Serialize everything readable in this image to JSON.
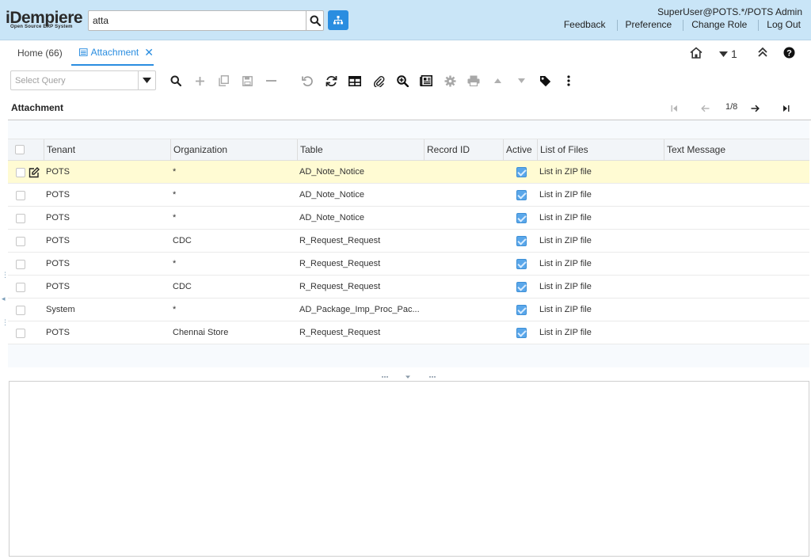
{
  "app": {
    "logo_main": "iDempiere",
    "logo_sub": "Open Source ERP System",
    "search_value": "atta",
    "user": "SuperUser@POTS.*/POTS Admin",
    "links": [
      "Feedback",
      "Preference",
      "Change Role",
      "Log Out"
    ]
  },
  "tabs": {
    "home": "Home (66)",
    "active": "Attachment",
    "count": "1"
  },
  "toolbar": {
    "query_placeholder": "Select Query"
  },
  "window": {
    "title": "Attachment",
    "page": "1/8"
  },
  "grid": {
    "columns": [
      "Tenant",
      "Organization",
      "Table",
      "Record ID",
      "Active",
      "List of Files",
      "Text Message"
    ],
    "rows": [
      {
        "tenant": "POTS",
        "org": "*",
        "table": "AD_Note_Notice",
        "record": "",
        "active": true,
        "files": "List in ZIP file",
        "msg": ""
      },
      {
        "tenant": "POTS",
        "org": "*",
        "table": "AD_Note_Notice",
        "record": "",
        "active": true,
        "files": "List in ZIP file",
        "msg": ""
      },
      {
        "tenant": "POTS",
        "org": "*",
        "table": "AD_Note_Notice",
        "record": "",
        "active": true,
        "files": "List in ZIP file",
        "msg": ""
      },
      {
        "tenant": "POTS",
        "org": "CDC",
        "table": "R_Request_Request",
        "record": "",
        "active": true,
        "files": "List in ZIP file",
        "msg": ""
      },
      {
        "tenant": "POTS",
        "org": "*",
        "table": "R_Request_Request",
        "record": "",
        "active": true,
        "files": "List in ZIP file",
        "msg": ""
      },
      {
        "tenant": "POTS",
        "org": "CDC",
        "table": "R_Request_Request",
        "record": "",
        "active": true,
        "files": "List in ZIP file",
        "msg": ""
      },
      {
        "tenant": "System",
        "org": "*",
        "table": "AD_Package_Imp_Proc_Pac...",
        "record": "",
        "active": true,
        "files": "List in ZIP file",
        "msg": ""
      },
      {
        "tenant": "POTS",
        "org": "Chennai Store",
        "table": "R_Request_Request",
        "record": "",
        "active": true,
        "files": "List in ZIP file",
        "msg": ""
      }
    ]
  },
  "colors": {
    "header_bg": "#c9e5f7",
    "accent": "#2a8de0",
    "selected_row": "#fffbd3"
  }
}
